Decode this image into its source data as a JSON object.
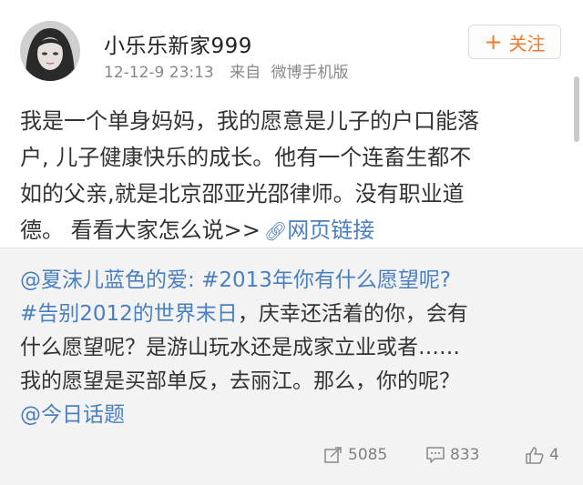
{
  "post": {
    "username": "小乐乐新家999",
    "time": "12-12-9 23:13",
    "source_prefix": "来自",
    "source": "微博手机版",
    "follow_label": "关注",
    "text_lines": [
      "我是一个单身妈妈，我的愿意是儿子的户口能落",
      "户, 儿子健康快乐的成长。他有一个连畜生都不",
      "如的父亲,就是北京邵亚光邵律师。没有职业道"
    ],
    "text_last": "德。 看看大家怎么说>>",
    "link_label": "网页链接",
    "icons": {
      "avatar": "user-avatar",
      "follow": "plus-icon",
      "link": "link-icon"
    }
  },
  "repost": {
    "mention_author": "@夏沫儿蓝色的爱:",
    "topic1": "#2013年你有什么愿望呢?",
    "topic2": "#告别2012的世界末日",
    "line2_rest": "，庆幸还活着的你，会有",
    "line3": "什么愿望呢？是游山玩水还是成家立业或者……",
    "line4": "我的愿望是买部单反，去丽江。那么，你的呢？",
    "mention_topic": "@今日话题"
  },
  "actions": {
    "repost_count": "5085",
    "comment_count": "833",
    "like_count": "4",
    "icons": [
      "repost-icon",
      "comment-icon",
      "like-icon"
    ]
  },
  "colors": {
    "link": "#4a7fc0",
    "follow_accent": "#f07a2b",
    "muted": "#888888",
    "repost_bg": "#f3f3f3"
  }
}
